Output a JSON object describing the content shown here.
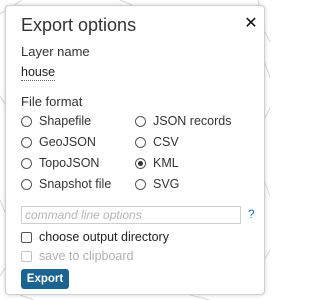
{
  "dialog": {
    "title": "Export options",
    "close_symbol": "✕"
  },
  "layer": {
    "label": "Layer name",
    "value": "house"
  },
  "format": {
    "label": "File format",
    "options": [
      {
        "label": "Shapefile",
        "checked": false
      },
      {
        "label": "GeoJSON",
        "checked": false
      },
      {
        "label": "TopoJSON",
        "checked": false
      },
      {
        "label": "Snapshot file",
        "checked": false
      },
      {
        "label": "JSON records",
        "checked": false
      },
      {
        "label": "CSV",
        "checked": false
      },
      {
        "label": "KML",
        "checked": true
      },
      {
        "label": "SVG",
        "checked": false
      }
    ],
    "selected": "KML"
  },
  "command_line": {
    "placeholder": "command line options",
    "value": "",
    "help_label": "?"
  },
  "checkboxes": {
    "choose_output_directory": {
      "label": "choose output directory",
      "checked": false,
      "enabled": true
    },
    "save_to_clipboard": {
      "label": "save to clipboard",
      "checked": false,
      "enabled": false
    }
  },
  "actions": {
    "export_label": "Export"
  },
  "colors": {
    "accent": "#1b6391",
    "help_link": "#1d72c4",
    "map_lines": "#dcdcdc"
  },
  "icons": {
    "close": "close-icon"
  }
}
